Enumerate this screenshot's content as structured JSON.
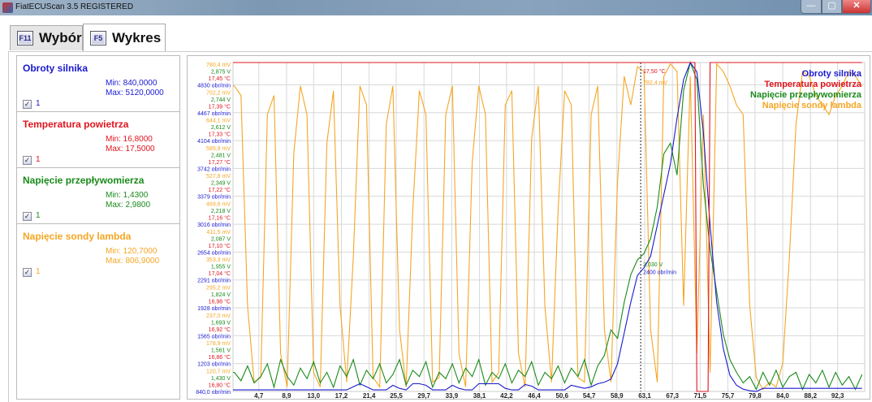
{
  "window": {
    "title": "FiatECUScan 3.5 REGISTERED",
    "minimize": "—",
    "maximize": "▢",
    "close": "✕"
  },
  "tabs": [
    {
      "key": "F11",
      "label": "Wybór",
      "active": false
    },
    {
      "key": "F5",
      "label": "Wykres",
      "active": true
    }
  ],
  "params": [
    {
      "name": "Obroty silnika",
      "min": "Min: 840,0000",
      "max": "Max: 5120,0000",
      "check": "✓",
      "check_label": "1",
      "color": "#1a1ad0"
    },
    {
      "name": "Temperatura powietrza",
      "min": "Min: 16,8000",
      "max": "Max: 17,5000",
      "check": "✓",
      "check_label": "1",
      "color": "#e0141e"
    },
    {
      "name": "Napięcie przepływomierza",
      "min": "Min: 1,4300",
      "max": "Max: 2,9800",
      "check": "✓",
      "check_label": "1",
      "color": "#1a8a1a"
    },
    {
      "name": "Napięcie sondy lambda",
      "min": "Min: 120,7000",
      "max": "Max: 806,9000",
      "check": "✓",
      "check_label": "1",
      "color": "#f5a623"
    }
  ],
  "chart_data": {
    "type": "line",
    "x_ticks": [
      "4,7",
      "8,9",
      "13,0",
      "17,2",
      "21,4",
      "25,5",
      "29,7",
      "33,9",
      "38,1",
      "42,2",
      "46,4",
      "50,6",
      "54,7",
      "58,9",
      "63,1",
      "67,3",
      "71,5",
      "75,7",
      "79,8",
      "84,0",
      "88,2",
      "92,3"
    ],
    "x_tick_values": [
      4.7,
      8.9,
      13.0,
      17.2,
      21.4,
      25.5,
      29.7,
      33.9,
      38.1,
      42.2,
      46.4,
      50.6,
      54.7,
      58.9,
      63.1,
      67.3,
      71.5,
      75.7,
      79.8,
      84.0,
      88.2,
      92.3
    ],
    "xlim": [
      0.8,
      96.4
    ],
    "grid": true,
    "legend_position": "top-right",
    "y_axis_levels": [
      {
        "mv": "780,4 mV",
        "v": "2,875 V",
        "c": "17,45 °C",
        "rpm": "4830 obr/min"
      },
      {
        "mv": "702,2 mV",
        "v": "2,744 V",
        "c": "17,39 °C",
        "rpm": "4467 obr/min"
      },
      {
        "mv": "644,1 mV",
        "v": "2,612 V",
        "c": "17,33 °C",
        "rpm": "4104 obr/min"
      },
      {
        "mv": "585,9 mV",
        "v": "2,481 V",
        "c": "17,27 °C",
        "rpm": "3742 obr/min"
      },
      {
        "mv": "527,8 mV",
        "v": "2,349 V",
        "c": "17,22 °C",
        "rpm": "3379 obr/min"
      },
      {
        "mv": "469,6 mV",
        "v": "2,218 V",
        "c": "17,16 °C",
        "rpm": "3016 obr/min"
      },
      {
        "mv": "411,5 mV",
        "v": "2,087 V",
        "c": "17,10 °C",
        "rpm": "2654 obr/min"
      },
      {
        "mv": "353,3 mV",
        "v": "1,955 V",
        "c": "17,04 °C",
        "rpm": "2291 obr/min"
      },
      {
        "mv": "295,2 mV",
        "v": "1,824 V",
        "c": "16,98 °C",
        "rpm": "1928 obr/min"
      },
      {
        "mv": "237,0 mV",
        "v": "1,693 V",
        "c": "16,92 °C",
        "rpm": "1565 obr/min"
      },
      {
        "mv": "178,9 mV",
        "v": "1,561 V",
        "c": "16,86 °C",
        "rpm": "1203 obr/min"
      },
      {
        "mv": "120,7 mV",
        "v": "1,430 V",
        "c": "16,80 °C",
        "rpm": "840,0 obr/min"
      }
    ],
    "cursor": {
      "x": 62.5,
      "readouts": [
        {
          "text": "17,50 °C",
          "series": 1,
          "value": 17.5
        },
        {
          "text": "782,4 mV",
          "series": 3,
          "value": 782.4
        },
        {
          "text": "2,030 V",
          "series": 2,
          "value": 2.03
        },
        {
          "text": "2400 obr/min",
          "series": 0,
          "value": 2400
        }
      ]
    },
    "x_start": 1,
    "x_step": 1,
    "series": [
      {
        "name": "Obroty silnika",
        "color": "#1a1ad0",
        "ylim": [
          840,
          5120
        ],
        "values": [
          860,
          860,
          860,
          860,
          860,
          860,
          860,
          860,
          860,
          860,
          860,
          860,
          860,
          860,
          860,
          860,
          860,
          860,
          900,
          940,
          900,
          860,
          860,
          860,
          920,
          880,
          860,
          940,
          940,
          920,
          860,
          860,
          860,
          920,
          880,
          860,
          860,
          940,
          940,
          940,
          940,
          880,
          860,
          860,
          930,
          910,
          860,
          860,
          860,
          860,
          860,
          920,
          900,
          880,
          900,
          940,
          960,
          1000,
          1200,
          1600,
          2000,
          2350,
          2450,
          2600,
          3000,
          3400,
          3800,
          4400,
          4900,
          5120,
          5000,
          4200,
          3000,
          2000,
          1400,
          1050,
          920,
          870,
          850,
          840,
          880,
          880,
          880,
          880,
          880,
          880,
          880,
          880,
          880,
          880,
          880,
          880,
          880,
          880,
          880,
          880
        ]
      },
      {
        "name": "Temperatura powietrza",
        "color": "#e0141e",
        "ylim": [
          16.8,
          17.5
        ],
        "step": true,
        "values": [
          17.5,
          17.5,
          17.5,
          17.5,
          17.5,
          17.5,
          17.5,
          17.5,
          17.5,
          17.5,
          17.5,
          17.5,
          17.5,
          17.5,
          17.5,
          17.5,
          17.5,
          17.5,
          17.5,
          17.5,
          17.5,
          17.5,
          17.5,
          17.5,
          17.5,
          17.5,
          17.5,
          17.5,
          17.5,
          17.5,
          17.5,
          17.5,
          17.5,
          17.5,
          17.5,
          17.5,
          17.5,
          17.5,
          17.5,
          17.5,
          17.5,
          17.5,
          17.5,
          17.5,
          17.5,
          17.5,
          17.5,
          17.5,
          17.5,
          17.5,
          17.5,
          17.5,
          17.5,
          17.5,
          17.5,
          17.5,
          17.5,
          17.5,
          17.5,
          17.5,
          17.5,
          17.5,
          17.5,
          17.5,
          17.5,
          17.5,
          17.5,
          17.5,
          17.5,
          17.5,
          16.8,
          16.8,
          17.5,
          17.5,
          17.5,
          17.5,
          17.5,
          17.5,
          17.5,
          17.5,
          17.5,
          17.5,
          17.5,
          17.5,
          17.5,
          17.5,
          17.5,
          17.5,
          17.5,
          17.5,
          17.5,
          17.5,
          17.5,
          17.5,
          17.5,
          17.5
        ]
      },
      {
        "name": "Napięcie przepływomierza",
        "color": "#1a8a1a",
        "ylim": [
          1.43,
          2.98
        ],
        "values": [
          1.52,
          1.48,
          1.55,
          1.47,
          1.5,
          1.56,
          1.45,
          1.58,
          1.5,
          1.46,
          1.54,
          1.49,
          1.57,
          1.47,
          1.52,
          1.45,
          1.55,
          1.5,
          1.58,
          1.46,
          1.53,
          1.49,
          1.56,
          1.47,
          1.51,
          1.58,
          1.46,
          1.53,
          1.5,
          1.57,
          1.45,
          1.52,
          1.49,
          1.56,
          1.47,
          1.54,
          1.5,
          1.58,
          1.46,
          1.52,
          1.49,
          1.56,
          1.47,
          1.53,
          1.5,
          1.57,
          1.46,
          1.52,
          1.49,
          1.55,
          1.47,
          1.54,
          1.5,
          1.58,
          1.46,
          1.55,
          1.6,
          1.72,
          1.68,
          1.85,
          1.98,
          2.05,
          2.08,
          2.15,
          2.3,
          2.55,
          2.6,
          2.45,
          2.85,
          2.98,
          2.9,
          2.4,
          2.1,
          1.9,
          1.7,
          1.58,
          1.52,
          1.47,
          1.5,
          1.44,
          1.52,
          1.46,
          1.53,
          1.45,
          1.5,
          1.52,
          1.44,
          1.51,
          1.47,
          1.53,
          1.45,
          1.52,
          1.46,
          1.5,
          1.44,
          1.51
        ]
      },
      {
        "name": "Napięcie sondy lambda",
        "color": "#f5a623",
        "ylim": [
          120.7,
          808.9
        ],
        "values": [
          760,
          740,
          300,
          140,
          150,
          700,
          740,
          200,
          130,
          620,
          760,
          700,
          160,
          130,
          640,
          750,
          300,
          140,
          400,
          760,
          720,
          150,
          130,
          680,
          760,
          250,
          130,
          500,
          750,
          700,
          140,
          150,
          700,
          760,
          200,
          130,
          600,
          760,
          700,
          140,
          160,
          720,
          750,
          200,
          130,
          650,
          760,
          300,
          140,
          500,
          750,
          720,
          150,
          140,
          700,
          760,
          250,
          140,
          560,
          780,
          720,
          800,
          790,
          250,
          140,
          780,
          806,
          790,
          300,
          780,
          200,
          700,
          160,
          806,
          790,
          760,
          720,
          700,
          300,
          150,
          125,
          140,
          130,
          180,
          400,
          680,
          790,
          780,
          740,
          720,
          700,
          740,
          760,
          790,
          780,
          760
        ]
      }
    ]
  }
}
